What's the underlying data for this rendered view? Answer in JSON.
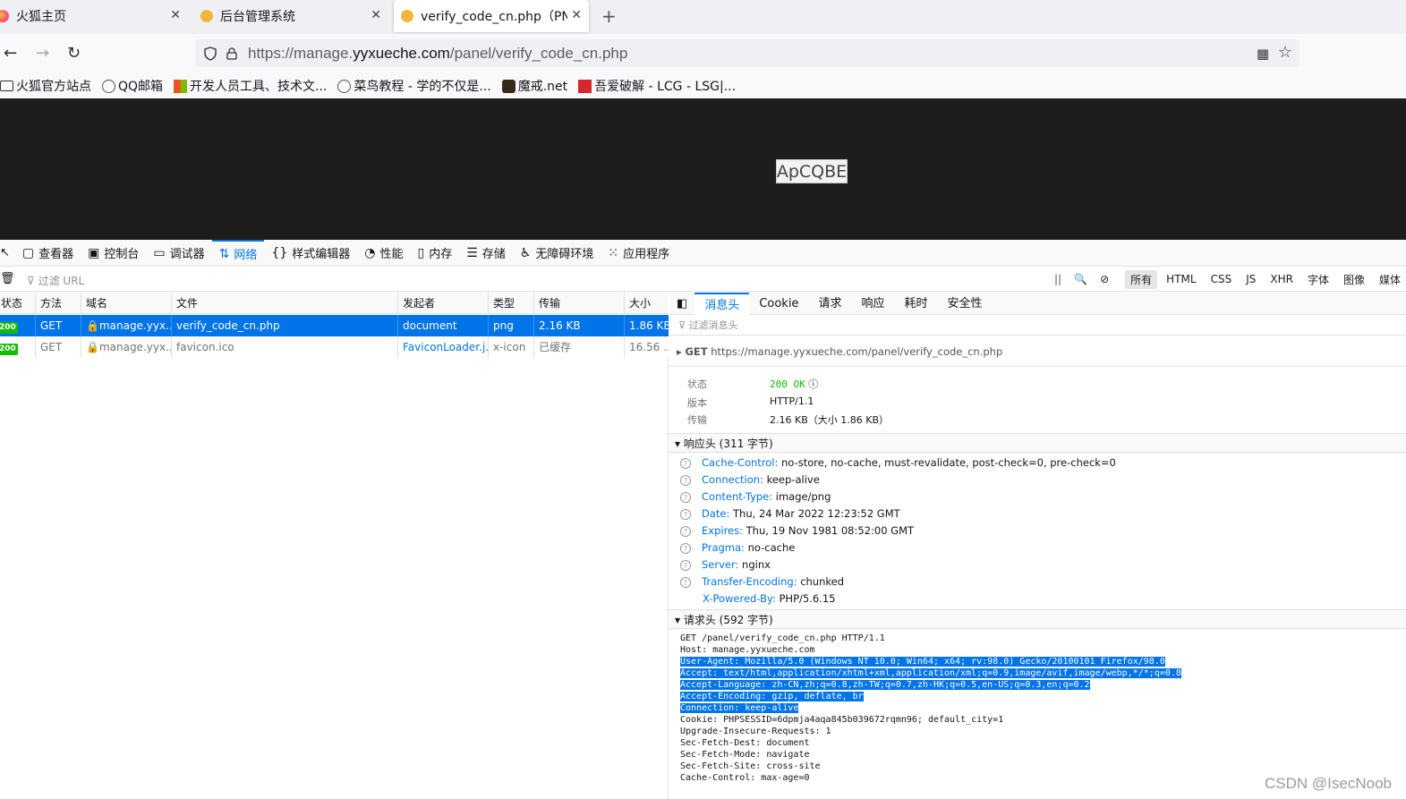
{
  "tabs": [
    {
      "title": "火狐主页",
      "icon": "firefox-icon"
    },
    {
      "title": "后台管理系统",
      "icon": "page-favicon-icon"
    },
    {
      "title": "verify_code_cn.php（PNG",
      "icon": "page-favicon-icon",
      "active": true
    }
  ],
  "newtab": "+",
  "url": {
    "prefix": "https://manage.",
    "domain": "yyxueche.com",
    "path": "/panel/verify_code_cn.php"
  },
  "bookmarks": [
    "火狐官方站点",
    "QQ邮箱",
    "开发人员工具、技术文...",
    "菜鸟教程 - 学的不仅是...",
    "魔戒.net",
    "吾爱破解 - LCG - LSG|..."
  ],
  "captcha": "ApCQBE",
  "devtools": {
    "tools": [
      "查看器",
      "控制台",
      "调试器",
      "网络",
      "样式编辑器",
      "性能",
      "内存",
      "存储",
      "无障碍环境",
      "应用程序"
    ],
    "active_tool": "网络",
    "filter_placeholder": "过滤 URL",
    "type_filters": [
      "所有",
      "HTML",
      "CSS",
      "JS",
      "XHR",
      "字体",
      "图像",
      "媒体"
    ],
    "pause": "||"
  },
  "table": {
    "headers": [
      "状态",
      "方法",
      "域名",
      "文件",
      "发起者",
      "类型",
      "传输",
      "大小"
    ],
    "rows": [
      {
        "status": "200",
        "method": "GET",
        "domain": "manage.yyx...",
        "file": "verify_code_cn.php",
        "initiator": "document",
        "type": "png",
        "transfer": "2.16 KB",
        "size": "1.86 KB"
      },
      {
        "status": "200",
        "method": "GET",
        "domain": "manage.yyx...",
        "file": "favicon.ico",
        "initiator": "FaviconLoader.j...",
        "type": "x-icon",
        "transfer": "已缓存",
        "size": "16.56 ..."
      }
    ]
  },
  "detail": {
    "tabs": [
      "消息头",
      "Cookie",
      "请求",
      "响应",
      "耗时",
      "安全性"
    ],
    "filter_placeholder": "过滤消息头",
    "summary_method": "GET",
    "summary_url": "https://manage.yyxueche.com/panel/verify_code_cn.php",
    "status_label": "状态",
    "status_value": "200 OK",
    "version_label": "版本",
    "version_value": "HTTP/1.1",
    "transfer_label": "传输",
    "transfer_value": "2.16 KB（大小 1.86 KB）",
    "response_section": "响应头 (311 字节)",
    "response_headers": [
      {
        "name": "Cache-Control:",
        "value": "no-store, no-cache, must-revalidate, post-check=0, pre-check=0"
      },
      {
        "name": "Connection:",
        "value": "keep-alive"
      },
      {
        "name": "Content-Type:",
        "value": "image/png"
      },
      {
        "name": "Date:",
        "value": "Thu, 24 Mar 2022 12:23:52 GMT"
      },
      {
        "name": "Expires:",
        "value": "Thu, 19 Nov 1981 08:52:00 GMT"
      },
      {
        "name": "Pragma:",
        "value": "no-cache"
      },
      {
        "name": "Server:",
        "value": "nginx"
      },
      {
        "name": "Transfer-Encoding:",
        "value": "chunked"
      },
      {
        "name": "X-Powered-By:",
        "value": "PHP/5.6.15"
      }
    ],
    "request_section": "请求头 (592 字节)",
    "raw_lines": [
      {
        "text": "GET /panel/verify_code_cn.php HTTP/1.1",
        "hl": false
      },
      {
        "text": "Host: manage.yyxueche.com",
        "hl": false
      },
      {
        "text": "User-Agent: Mozilla/5.0 (Windows NT 10.0; Win64; x64; rv:98.0) Gecko/20100101 Firefox/98.0",
        "hl": true
      },
      {
        "text": "Accept: text/html,application/xhtml+xml,application/xml;q=0.9,image/avif,image/webp,*/*;q=0.8",
        "hl": true
      },
      {
        "text": "Accept-Language: zh-CN,zh;q=0.8,zh-TW;q=0.7,zh-HK;q=0.5,en-US;q=0.3,en;q=0.2",
        "hl": true
      },
      {
        "text": "Accept-Encoding: gzip, deflate, br",
        "hl": true
      },
      {
        "text": "Connection: keep-alive",
        "hl": true
      },
      {
        "text": "Cookie: PHPSESSID=6dpmja4aqa845b039672rqmn96; default_city=1",
        "hl": false
      },
      {
        "text": "Upgrade-Insecure-Requests: 1",
        "hl": false
      },
      {
        "text": "Sec-Fetch-Dest: document",
        "hl": false
      },
      {
        "text": "Sec-Fetch-Mode: navigate",
        "hl": false
      },
      {
        "text": "Sec-Fetch-Site: cross-site",
        "hl": false
      },
      {
        "text": "Cache-Control: max-age=0",
        "hl": false
      }
    ]
  },
  "watermark": "CSDN @IsecNoob",
  "colors": {
    "accent": "#0074e8",
    "ok": "#12bc00",
    "devtools_bg": "#f9f9fa"
  }
}
